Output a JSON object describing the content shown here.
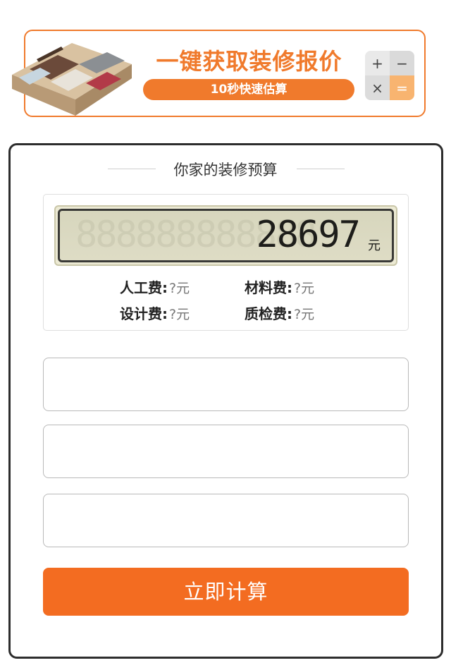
{
  "banner": {
    "title": "一键获取装修报价",
    "subtitle": "10秒快速估算",
    "keys": [
      "+",
      "−",
      "×",
      "="
    ]
  },
  "budget": {
    "title": "你家的装修预算",
    "total": "28697",
    "unit": "元",
    "fees": [
      {
        "name": "人工费:",
        "value": "?元"
      },
      {
        "name": "材料费:",
        "value": "?元"
      },
      {
        "name": "设计费:",
        "value": "?元"
      },
      {
        "name": "质检费:",
        "value": "?元"
      }
    ]
  },
  "form": {
    "fields": [
      {
        "placeholder": ""
      },
      {
        "placeholder": ""
      },
      {
        "placeholder": ""
      }
    ],
    "submit_label": "立即计算"
  },
  "colors": {
    "accent": "#f07a2c",
    "button": "#f36c21",
    "border": "#2d2d2d"
  }
}
